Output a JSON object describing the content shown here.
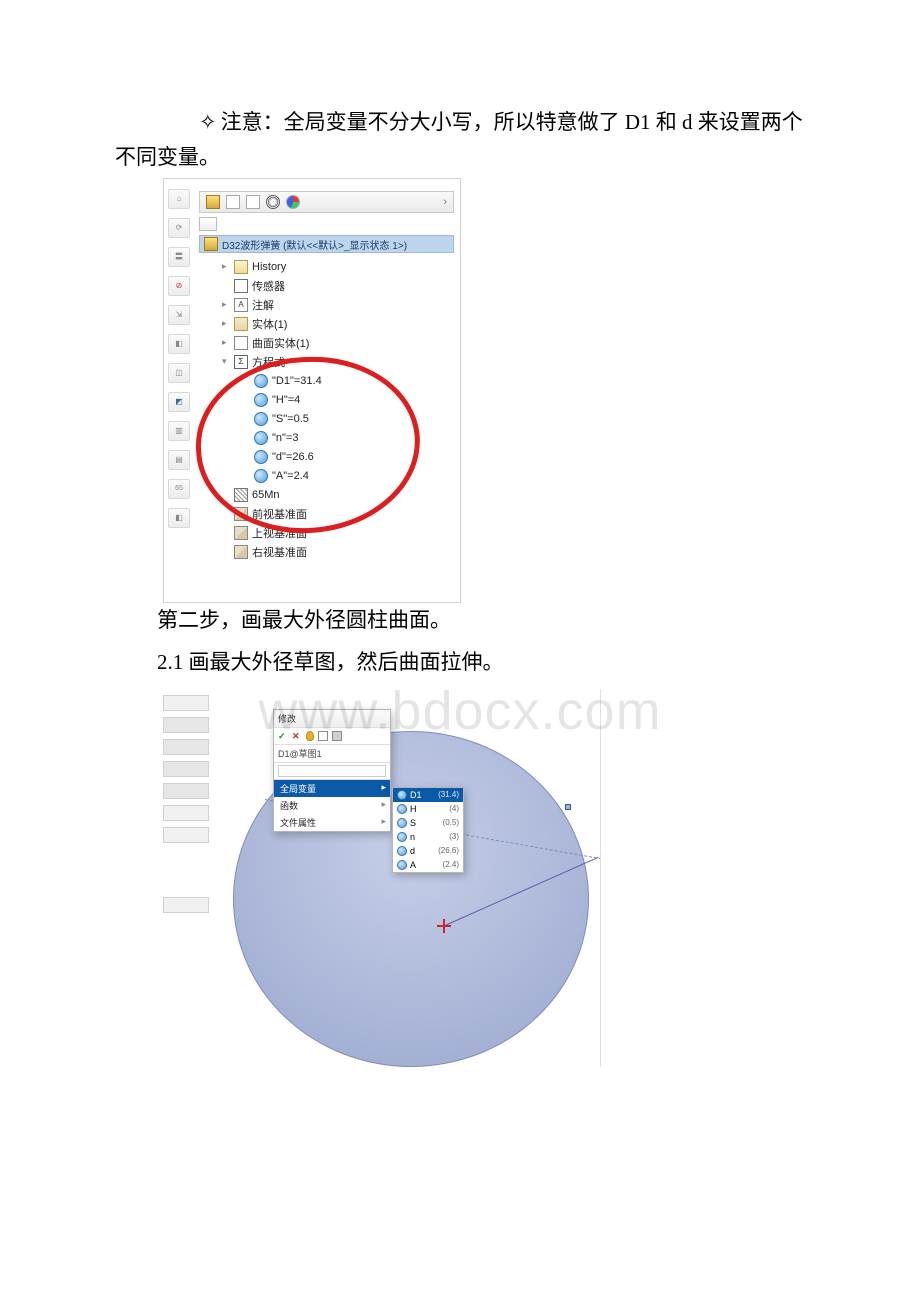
{
  "text": {
    "note_prefix": "✧",
    "note": "注意：全局变量不分大小写，所以特意做了 D1 和 d 来设置两个不同变量。",
    "step2": "第二步，画最大外径圆柱曲面。",
    "step2_1": "2.1 画最大外径草图，然后曲面拉伸。",
    "watermark": "www.bdocx.com"
  },
  "tree": {
    "part_name": "D32波形弹簧  (默认<<默认>_显示状态 1>)",
    "items": [
      {
        "level": 1,
        "icon": "folder",
        "label": "History",
        "expandable": true
      },
      {
        "level": 1,
        "icon": "sensor",
        "label": "传感器",
        "expandable": false
      },
      {
        "level": 1,
        "icon": "a",
        "label": "注解",
        "expandable": true
      },
      {
        "level": 1,
        "icon": "body",
        "label": "实体(1)",
        "expandable": true
      },
      {
        "level": 1,
        "icon": "surf",
        "label": "曲面实体(1)",
        "expandable": true
      },
      {
        "level": 1,
        "icon": "eq",
        "label": "方程式",
        "expandable": true,
        "open": true
      },
      {
        "level": 2,
        "icon": "globe",
        "label": "\"D1\"=31.4"
      },
      {
        "level": 2,
        "icon": "globe",
        "label": "\"H\"=4"
      },
      {
        "level": 2,
        "icon": "globe",
        "label": "\"S\"=0.5"
      },
      {
        "level": 2,
        "icon": "globe",
        "label": "\"n\"=3"
      },
      {
        "level": 2,
        "icon": "globe",
        "label": "\"d\"=26.6"
      },
      {
        "level": 2,
        "icon": "globe",
        "label": "\"A\"=2.4"
      },
      {
        "level": 1,
        "icon": "mat",
        "label": "65Mn"
      },
      {
        "level": 1,
        "icon": "plane",
        "label": "前视基准面"
      },
      {
        "level": 1,
        "icon": "plane",
        "label": "上视基准面"
      },
      {
        "level": 1,
        "icon": "plane",
        "label": "右视基准面"
      }
    ]
  },
  "popup": {
    "title": "修改",
    "dim_name": "D1@草图1",
    "list": [
      {
        "label": "全局变量",
        "selected": true
      },
      {
        "label": "函数"
      },
      {
        "label": "文件属性"
      }
    ],
    "submenu": [
      {
        "name": "D1",
        "val": "(31.4)",
        "selected": true
      },
      {
        "name": "H",
        "val": "(4)"
      },
      {
        "name": "S",
        "val": "(0.5)"
      },
      {
        "name": "n",
        "val": "(3)"
      },
      {
        "name": "d",
        "val": "(26.6)"
      },
      {
        "name": "A",
        "val": "(2.4)"
      }
    ]
  }
}
